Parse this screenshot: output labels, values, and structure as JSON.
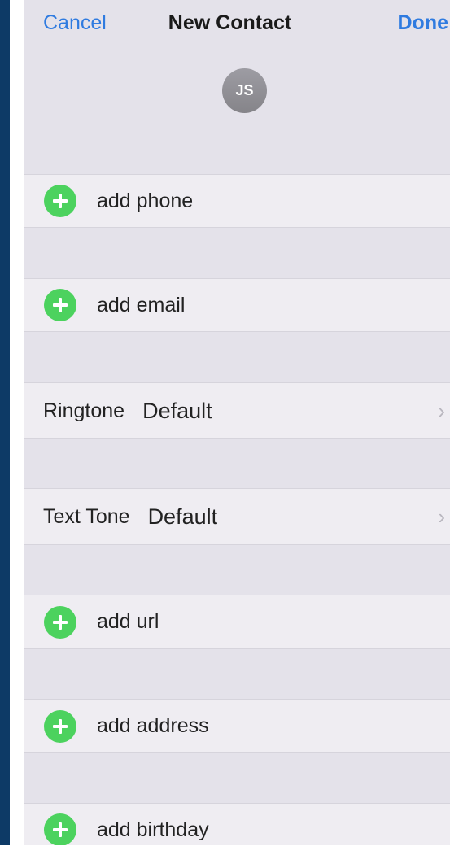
{
  "header": {
    "cancel_label": "Cancel",
    "title": "New Contact",
    "done_label": "Done"
  },
  "avatar": {
    "initials": "JS"
  },
  "rows": {
    "add_phone": "add phone",
    "add_email": "add email",
    "ringtone": {
      "label": "Ringtone",
      "value": "Default"
    },
    "text_tone": {
      "label": "Text Tone",
      "value": "Default"
    },
    "add_url": "add url",
    "add_address": "add address",
    "add_birthday": "add birthday"
  },
  "icons": {
    "add": "plus-circle-icon",
    "disclosure": "chevron-right-icon"
  },
  "colors": {
    "accent": "#2f7be0",
    "add_green": "#4cd25e",
    "group_background": "#e4e2ea",
    "row_background": "#efedf2",
    "side_bar": "#0d3a66"
  }
}
